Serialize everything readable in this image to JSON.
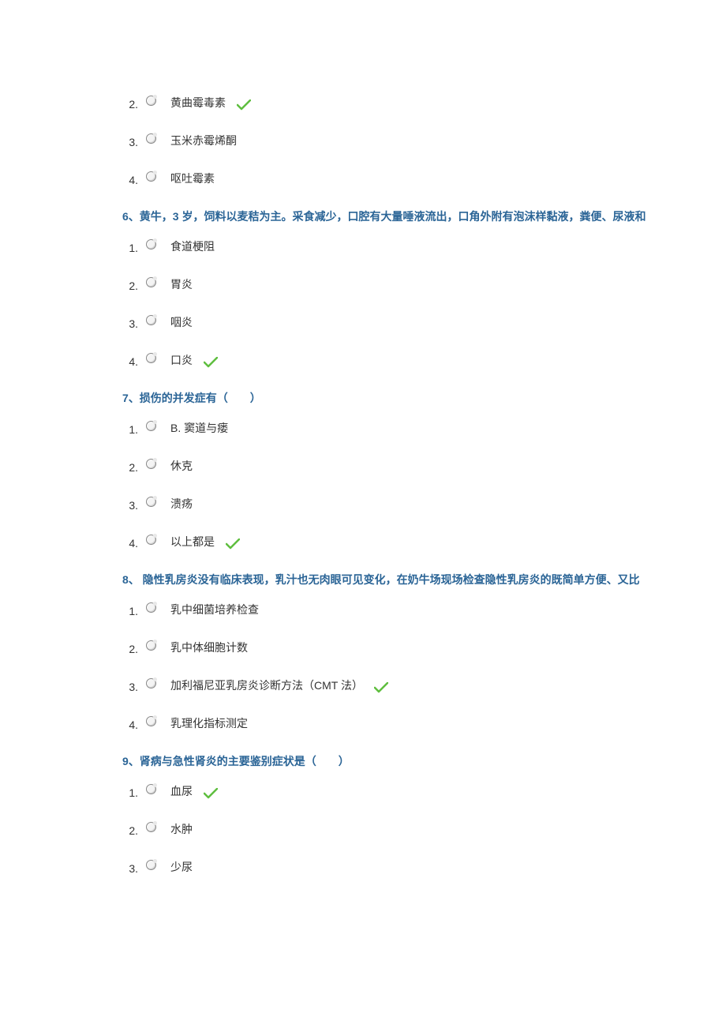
{
  "q5_partial": {
    "options": [
      {
        "num": "2.",
        "text": "黄曲霉毒素",
        "correct": true
      },
      {
        "num": "3.",
        "text": "玉米赤霉烯酮",
        "correct": false
      },
      {
        "num": "4.",
        "text": "呕吐霉素",
        "correct": false
      }
    ]
  },
  "q6": {
    "title": "6、黄牛，3 岁，饲料以麦秸为主。采食减少，口腔有大量唾液流出，口角外附有泡沫样黏液，粪便、尿液和",
    "options": [
      {
        "num": "1.",
        "text": "食道梗阻",
        "correct": false
      },
      {
        "num": "2.",
        "text": "胃炎",
        "correct": false
      },
      {
        "num": "3.",
        "text": "咽炎",
        "correct": false
      },
      {
        "num": "4.",
        "text": "口炎",
        "correct": true
      }
    ]
  },
  "q7": {
    "title": "7、损伤的并发症有（　　）",
    "options": [
      {
        "num": "1.",
        "text": "B. 窦道与瘘",
        "correct": false
      },
      {
        "num": "2.",
        "text": "休克",
        "correct": false
      },
      {
        "num": "3.",
        "text": "溃疡",
        "correct": false
      },
      {
        "num": "4.",
        "text": "以上都是",
        "correct": true
      }
    ]
  },
  "q8": {
    "title": "8、 隐性乳房炎没有临床表现，乳汁也无肉眼可见变化，在奶牛场现场检查隐性乳房炎的既简单方便、又比",
    "options": [
      {
        "num": "1.",
        "text": "乳中细菌培养检查",
        "correct": false
      },
      {
        "num": "2.",
        "text": "乳中体细胞计数",
        "correct": false
      },
      {
        "num": "3.",
        "text": "加利福尼亚乳房炎诊断方法（CMT 法）",
        "correct": true
      },
      {
        "num": "4.",
        "text": "乳理化指标测定",
        "correct": false
      }
    ]
  },
  "q9": {
    "title": "9、肾病与急性肾炎的主要鉴别症状是（　　）",
    "options": [
      {
        "num": "1.",
        "text": "血尿",
        "correct": true
      },
      {
        "num": "2.",
        "text": "水肿",
        "correct": false
      },
      {
        "num": "3.",
        "text": "少尿",
        "correct": false
      }
    ]
  }
}
